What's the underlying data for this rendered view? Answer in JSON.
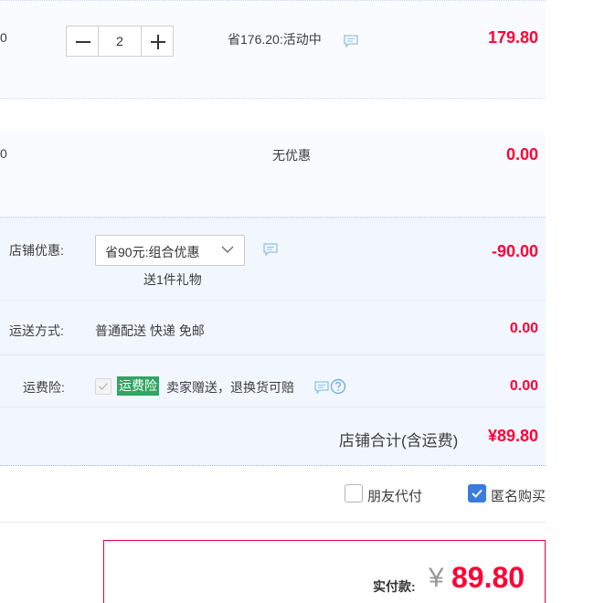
{
  "items": [
    {
      "price_fragment": "0",
      "quantity": "2",
      "promo": "省176.20:活动中",
      "subtotal": "179.80"
    },
    {
      "price_fragment": "0",
      "promo": "无优惠",
      "subtotal": "0.00"
    }
  ],
  "shop_discount": {
    "label": "店铺优惠:",
    "selected": "省90元:组合优惠",
    "gift": "送1件礼物",
    "amount": "-90.00"
  },
  "shipping": {
    "label": "运送方式:",
    "method": "普通配送 快递 免邮",
    "amount": "0.00"
  },
  "insurance": {
    "label": "运费险:",
    "badge": "运费险",
    "text": "卖家赠送，退换货可赔",
    "amount": "0.00"
  },
  "shop_total": {
    "label": "店铺合计(含运费)",
    "amount": "¥89.80"
  },
  "options": {
    "friend_pay": "朋友代付",
    "anonymous": "匿名购买",
    "friend_pay_checked": false,
    "anonymous_checked": true
  },
  "payment": {
    "label": "实付款:",
    "currency": "¥",
    "amount": "89.80"
  },
  "colors": {
    "price_red": "#ff0036",
    "badge_green": "#2fa561",
    "checkbox_blue": "#3a7bde",
    "row_bg": "#f2f7ff"
  },
  "icons": [
    "minus-icon",
    "plus-icon",
    "message-icon",
    "chevron-down-icon",
    "check-icon",
    "question-icon"
  ]
}
